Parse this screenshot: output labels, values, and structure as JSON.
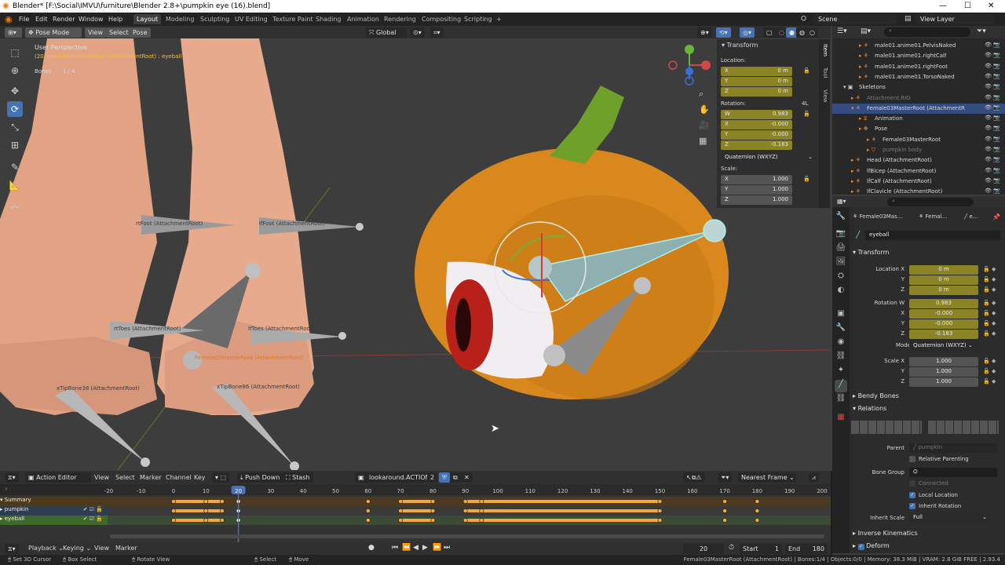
{
  "window": {
    "title": "Blender* [F:\\Social\\IMVU\\furniture\\Blender 2.8+\\pumpkin eye (16).blend]",
    "min": "—",
    "max": "☐",
    "close": "✕"
  },
  "menu": [
    "File",
    "Edit",
    "Render",
    "Window",
    "Help"
  ],
  "workspaces": [
    "Layout",
    "Modeling",
    "Sculpting",
    "UV Editing",
    "Texture Paint",
    "Shading",
    "Animation",
    "Rendering",
    "Compositing",
    "Scripting"
  ],
  "active_workspace": "Layout",
  "scene": "Scene",
  "view_layer": "View Layer",
  "viewport_header": {
    "mode": "Pose Mode",
    "view": "View",
    "select": "Select",
    "pose": "Pose",
    "orientation": "Global"
  },
  "viewport": {
    "perspective": "User Perspective",
    "object_info": "(20) Female03MasterRoot (AttachmentRoot) : eyeball",
    "bones_label": "Bones",
    "bones_count": "1 / 4",
    "bone_labels": {
      "rtfoot": "rtFoot (AttachmentRoot)",
      "lffoot": "lfFoot (AttachmentRoot)",
      "rttoes": "rtToes (AttachmentRoot)",
      "lftoes": "lfToes (AttachmentRoot)",
      "master": "Female03MasterRoot (AttachmentRoot)",
      "xtip38": "xTipBone38 (AttachmentRoot)",
      "xtip86": "xTipBone86 (AttachmentRoot)"
    }
  },
  "npanel": {
    "title": "Transform",
    "location_label": "Location:",
    "location": [
      {
        "axis": "X",
        "value": "0 m"
      },
      {
        "axis": "Y",
        "value": "0 m"
      },
      {
        "axis": "Z",
        "value": "0 m"
      }
    ],
    "rotation_label": "Rotation:",
    "rotation_mode_short": "4L",
    "rotation": [
      {
        "axis": "W",
        "value": "0.983"
      },
      {
        "axis": "X",
        "value": "-0.000"
      },
      {
        "axis": "Y",
        "value": "-0.000"
      },
      {
        "axis": "Z",
        "value": "-0.183"
      }
    ],
    "rotation_mode": "Quaternion (WXYZ)",
    "scale_label": "Scale:",
    "scale": [
      {
        "axis": "X",
        "value": "1.000"
      },
      {
        "axis": "Y",
        "value": "1.000"
      },
      {
        "axis": "Z",
        "value": "1.000"
      }
    ],
    "tabs": [
      "Item",
      "Tool",
      "View"
    ]
  },
  "outliner": {
    "rows": [
      {
        "label": "male01.anime01.PelvisNaked",
        "indent": 3,
        "type": "bone"
      },
      {
        "label": "male01.anime01.rightCalf",
        "indent": 3,
        "type": "bone"
      },
      {
        "label": "male01.anime01.rightFoot",
        "indent": 3,
        "type": "bone"
      },
      {
        "label": "male01.anime01.TorsoNaked",
        "indent": 3,
        "type": "bone"
      },
      {
        "label": "Skeletons",
        "indent": 1,
        "type": "collection"
      },
      {
        "label": "Attachment.RIG",
        "indent": 2,
        "type": "armature-dim"
      },
      {
        "label": "Female03MasterRoot (AttachmentR",
        "indent": 2,
        "type": "armature-sel"
      },
      {
        "label": "Animation",
        "indent": 3,
        "type": "anim"
      },
      {
        "label": "Pose",
        "indent": 3,
        "type": "pose"
      },
      {
        "label": "Female03MasterRoot",
        "indent": 4,
        "type": "data"
      },
      {
        "label": "pumpkin body",
        "indent": 4,
        "type": "dim"
      },
      {
        "label": "Head (AttachmentRoot)",
        "indent": 2,
        "type": "armature"
      },
      {
        "label": "lfBicep (AttachmentRoot)",
        "indent": 2,
        "type": "armature"
      },
      {
        "label": "lfCalf (AttachmentRoot)",
        "indent": 2,
        "type": "armature"
      },
      {
        "label": "lfClavicle (AttachmentRoot)",
        "indent": 2,
        "type": "armature"
      }
    ]
  },
  "properties": {
    "breadcrumb": [
      "Female03Mas...",
      "Femal...",
      "e..."
    ],
    "bone_name": "eyeball",
    "transform_title": "Transform",
    "location": [
      {
        "label": "Location X",
        "value": "0 m"
      },
      {
        "label": "Y",
        "value": "0 m"
      },
      {
        "label": "Z",
        "value": "0 m"
      }
    ],
    "rotation": [
      {
        "label": "Rotation W",
        "value": "0.983"
      },
      {
        "label": "X",
        "value": "-0.000"
      },
      {
        "label": "Y",
        "value": "-0.000"
      },
      {
        "label": "Z",
        "value": "-0.183"
      }
    ],
    "mode_label": "Mode",
    "mode_value": "Quaternion (WXYZ)",
    "scale": [
      {
        "label": "Scale X",
        "value": "1.000"
      },
      {
        "label": "Y",
        "value": "1.000"
      },
      {
        "label": "Z",
        "value": "1.000"
      }
    ],
    "bendy_bones": "Bendy Bones",
    "relations": "Relations",
    "parent_label": "Parent",
    "parent_value": "pumpkin",
    "relative_parenting": "Relative Parenting",
    "bone_group_label": "Bone Group",
    "connected": "Connected",
    "local_location": "Local Location",
    "inherit_rotation": "Inherit Rotation",
    "inherit_scale_label": "Inherit Scale",
    "inherit_scale_value": "Full",
    "inverse_kinematics": "Inverse Kinematics",
    "deform": "Deform"
  },
  "dopesheet": {
    "editor": "Action Editor",
    "menus": [
      "View",
      "Select",
      "Marker",
      "Channel",
      "Key"
    ],
    "push_down": "Push Down",
    "stash": "Stash",
    "action": "lookaround.ACTION",
    "users": "2",
    "snapping": "Nearest Frame",
    "ruler": [
      "-20",
      "-10",
      "0",
      "10",
      "20",
      "30",
      "40",
      "50",
      "60",
      "70",
      "80",
      "90",
      "100",
      "110",
      "120",
      "130",
      "140",
      "150",
      "160",
      "170",
      "180",
      "190",
      "200"
    ],
    "current_frame": "20",
    "channels": [
      "Summary",
      "pumpkin",
      "eyeball"
    ],
    "keyframes": [
      0,
      10,
      15,
      20,
      60,
      70,
      80,
      90,
      95,
      150,
      170,
      180
    ],
    "holds": [
      [
        0,
        15
      ],
      [
        70,
        80
      ],
      [
        90,
        95
      ],
      [
        95,
        150
      ]
    ]
  },
  "timeline": {
    "menus": [
      "Playback",
      "Keying",
      "View",
      "Marker"
    ],
    "frame": "20",
    "start_label": "Start",
    "start": "1",
    "end_label": "End",
    "end": "180"
  },
  "status": {
    "left": [
      "Set 3D Cursor",
      "Box Select",
      "Rotate View",
      "Select",
      "Move"
    ],
    "right": "Female03MasterRoot (AttachmentRoot) | Bones:1/4 | Objects:0/0 | Memory: 38.3 MiB | VRAM: 2.8 GiB FREE | 2.93.4"
  },
  "colors": {
    "accent": "#4772b3",
    "field_yellow": "#8a8427",
    "keyframe": "#f2a83c",
    "pumpkin": "#d48a1e",
    "stem": "#6fa02a",
    "skin": "#e7a98a"
  }
}
